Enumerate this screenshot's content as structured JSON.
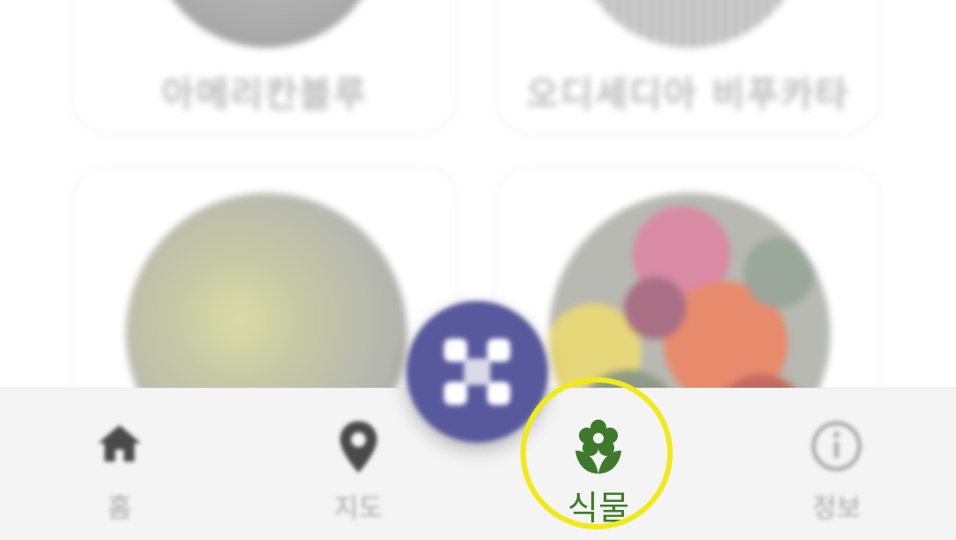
{
  "plant_cards": [
    {
      "name": "아메리칸블루"
    },
    {
      "name": "오디세디아 비푸카타"
    },
    {
      "name": ""
    },
    {
      "name": ""
    }
  ],
  "fab": {
    "icon": "scan-icon"
  },
  "bottom_nav": {
    "items": [
      {
        "label": "홈",
        "icon": "home-icon",
        "active": false
      },
      {
        "label": "지도",
        "icon": "map-pin-icon",
        "active": false
      },
      {
        "label": "식물",
        "icon": "flower-icon",
        "active": true
      },
      {
        "label": "정보",
        "icon": "info-icon",
        "active": false
      }
    ]
  },
  "colors": {
    "accent_green": "#3f7a2c",
    "fab_purple": "#57599c",
    "highlight_yellow": "#f0ea1a",
    "inactive_gray": "#a8a8a8"
  }
}
